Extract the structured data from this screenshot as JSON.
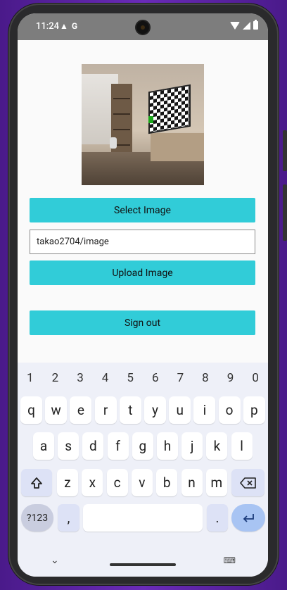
{
  "status": {
    "time": "11:24",
    "left_icons": [
      "warning-icon",
      "google-icon"
    ],
    "right_icons": [
      "wifi-icon",
      "signal-icon",
      "battery-icon"
    ]
  },
  "app": {
    "select_button": "Select Image",
    "path_input": {
      "value": "takao2704/image",
      "placeholder": ""
    },
    "upload_button": "Upload Image",
    "signout_button": "Sign out"
  },
  "keyboard": {
    "numbers": [
      "1",
      "2",
      "3",
      "4",
      "5",
      "6",
      "7",
      "8",
      "9",
      "0"
    ],
    "row1": [
      "q",
      "w",
      "e",
      "r",
      "t",
      "y",
      "u",
      "i",
      "o",
      "p"
    ],
    "row2": [
      "a",
      "s",
      "d",
      "f",
      "g",
      "h",
      "j",
      "k",
      "l"
    ],
    "row3": [
      "z",
      "x",
      "c",
      "v",
      "b",
      "n",
      "m"
    ],
    "sym_label": "?123",
    "comma": ",",
    "period": "."
  },
  "colors": {
    "accent": "#31ccd8",
    "status_bar": "#7d7d7d",
    "keyboard_bg": "#eef0f8"
  }
}
